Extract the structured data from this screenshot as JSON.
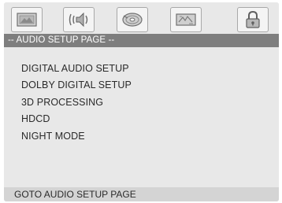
{
  "tabs": [
    {
      "icon": "picture-icon"
    },
    {
      "icon": "audio-icon"
    },
    {
      "icon": "disc-icon"
    },
    {
      "icon": "preferences-icon"
    },
    {
      "icon": "lock-icon"
    }
  ],
  "page_title": "-- AUDIO SETUP PAGE --",
  "menu": {
    "items": [
      {
        "label": "DIGITAL AUDIO SETUP"
      },
      {
        "label": "DOLBY DIGITAL SETUP"
      },
      {
        "label": "3D PROCESSING"
      },
      {
        "label": "HDCD"
      },
      {
        "label": "NIGHT MODE"
      }
    ]
  },
  "status": "GOTO AUDIO SETUP PAGE",
  "colors": {
    "background": "#e8e8e8",
    "title_bar": "#7e7e7e",
    "status_bar": "#d4d4d4",
    "text": "#2a2a2a"
  }
}
